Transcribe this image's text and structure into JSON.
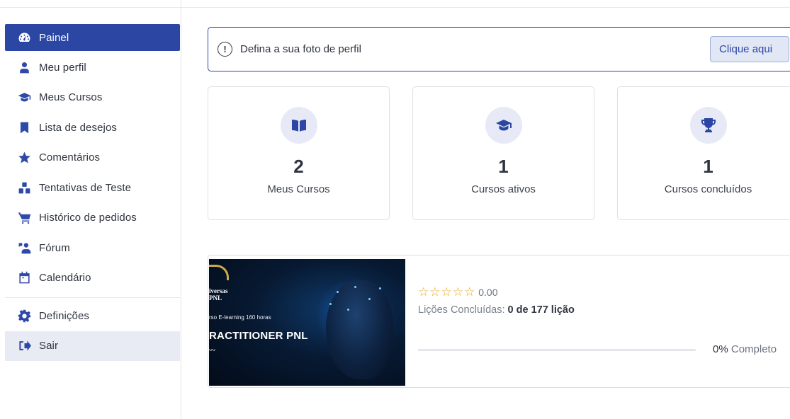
{
  "sidebar": {
    "items": [
      {
        "label": "Painel",
        "icon": "dashboard-icon"
      },
      {
        "label": "Meu perfil",
        "icon": "user-icon"
      },
      {
        "label": "Meus Cursos",
        "icon": "graduation-cap-icon"
      },
      {
        "label": "Lista de desejos",
        "icon": "bookmark-icon"
      },
      {
        "label": "Comentários",
        "icon": "star-icon"
      },
      {
        "label": "Tentativas de Teste",
        "icon": "quiz-blocks-icon"
      },
      {
        "label": "Histórico de pedidos",
        "icon": "cart-icon"
      },
      {
        "label": "Fórum",
        "icon": "forum-icon"
      },
      {
        "label": "Calendário",
        "icon": "calendar-icon"
      }
    ],
    "settings_label": "Definições",
    "logout_label": "Sair"
  },
  "notice": {
    "text": "Defina a sua foto de perfil",
    "button_label": "Clique aqui",
    "icon": "!"
  },
  "stats": [
    {
      "value": "2",
      "label": "Meus Cursos",
      "icon": "book-open-icon"
    },
    {
      "value": "1",
      "label": "Cursos ativos",
      "icon": "graduation-cap-icon"
    },
    {
      "value": "1",
      "label": "Cursos concluídos",
      "icon": "trophy-icon"
    }
  ],
  "course": {
    "thumbnail": {
      "brand_line1": "iversas",
      "brand_line2": "PNL",
      "subtitle": "rso E-learning 160 horas",
      "title": "RACTITIONER PNL",
      "wave": "〰"
    },
    "rating": "0.00",
    "stars": [
      "☆",
      "☆",
      "☆",
      "☆",
      "☆"
    ],
    "lessons_label": "Lições Concluídas:",
    "lessons_value": "0 de 177 lição",
    "progress_percent": 0,
    "progress_value": "0%",
    "progress_label": "Completo"
  },
  "colors": {
    "accent": "#2b46a3",
    "star": "#e8a317"
  }
}
